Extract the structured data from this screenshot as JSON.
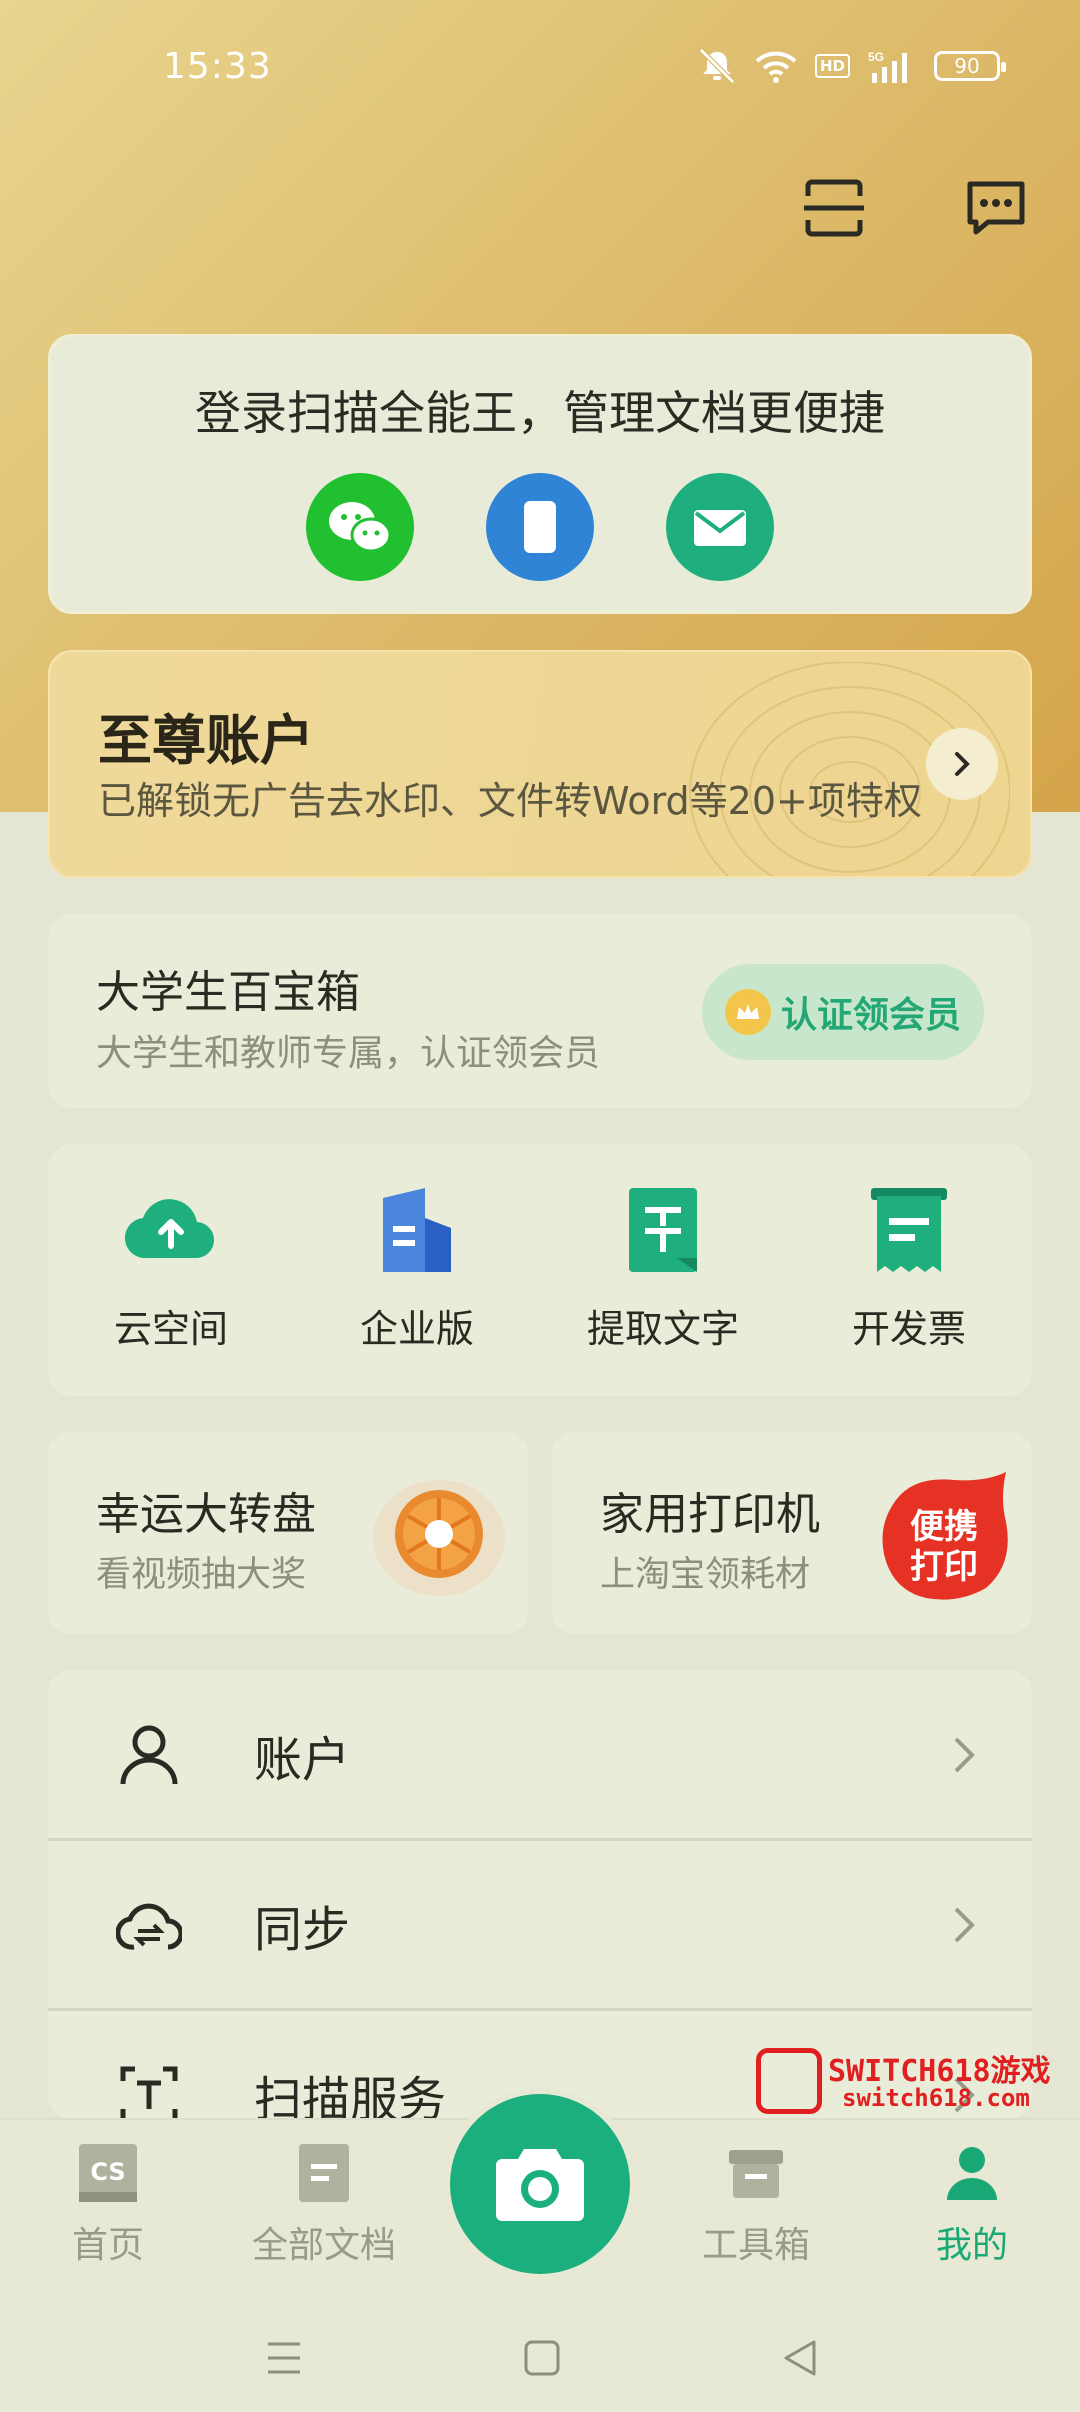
{
  "status": {
    "time": "15:33",
    "battery": "90",
    "network": "5G",
    "hd": "HD"
  },
  "login": {
    "title": "登录扫描全能王，管理文档更便捷",
    "methods": [
      "wechat-icon",
      "phone-icon",
      "mail-icon"
    ]
  },
  "vip": {
    "title": "至尊账户",
    "subtitle": "已解锁无广告去水印、文件转Word等20+项特权"
  },
  "student": {
    "title": "大学生百宝箱",
    "subtitle": "大学生和教师专属，认证领会员",
    "badge": "认证领会员"
  },
  "tools": [
    {
      "label": "云空间",
      "icon": "cloud-upload-icon"
    },
    {
      "label": "企业版",
      "icon": "building-icon"
    },
    {
      "label": "提取文字",
      "icon": "text-extract-icon"
    },
    {
      "label": "开发票",
      "icon": "invoice-icon"
    }
  ],
  "promos": [
    {
      "title": "幸运大转盘",
      "subtitle": "看视频抽大奖"
    },
    {
      "title": "家用打印机",
      "subtitle": "上淘宝领耗材",
      "sticker_text": "便携打印"
    }
  ],
  "menu": [
    {
      "label": "账户",
      "icon": "person-icon"
    },
    {
      "label": "同步",
      "icon": "cloud-sync-icon"
    },
    {
      "label": "扫描服务",
      "icon": "scan-text-icon"
    }
  ],
  "watermark": {
    "line1": "SWITCH618游戏",
    "line2": "switch618.com"
  },
  "tabs": [
    {
      "label": "首页",
      "icon": "cs-logo-icon"
    },
    {
      "label": "全部文档",
      "icon": "document-icon"
    },
    {
      "label": "工具箱",
      "icon": "toolbox-icon"
    },
    {
      "label": "我的",
      "icon": "profile-icon"
    }
  ],
  "colors": {
    "accent": "#1aaf7c",
    "hero_gold": "#dcb968",
    "text": "#2a2a22"
  }
}
